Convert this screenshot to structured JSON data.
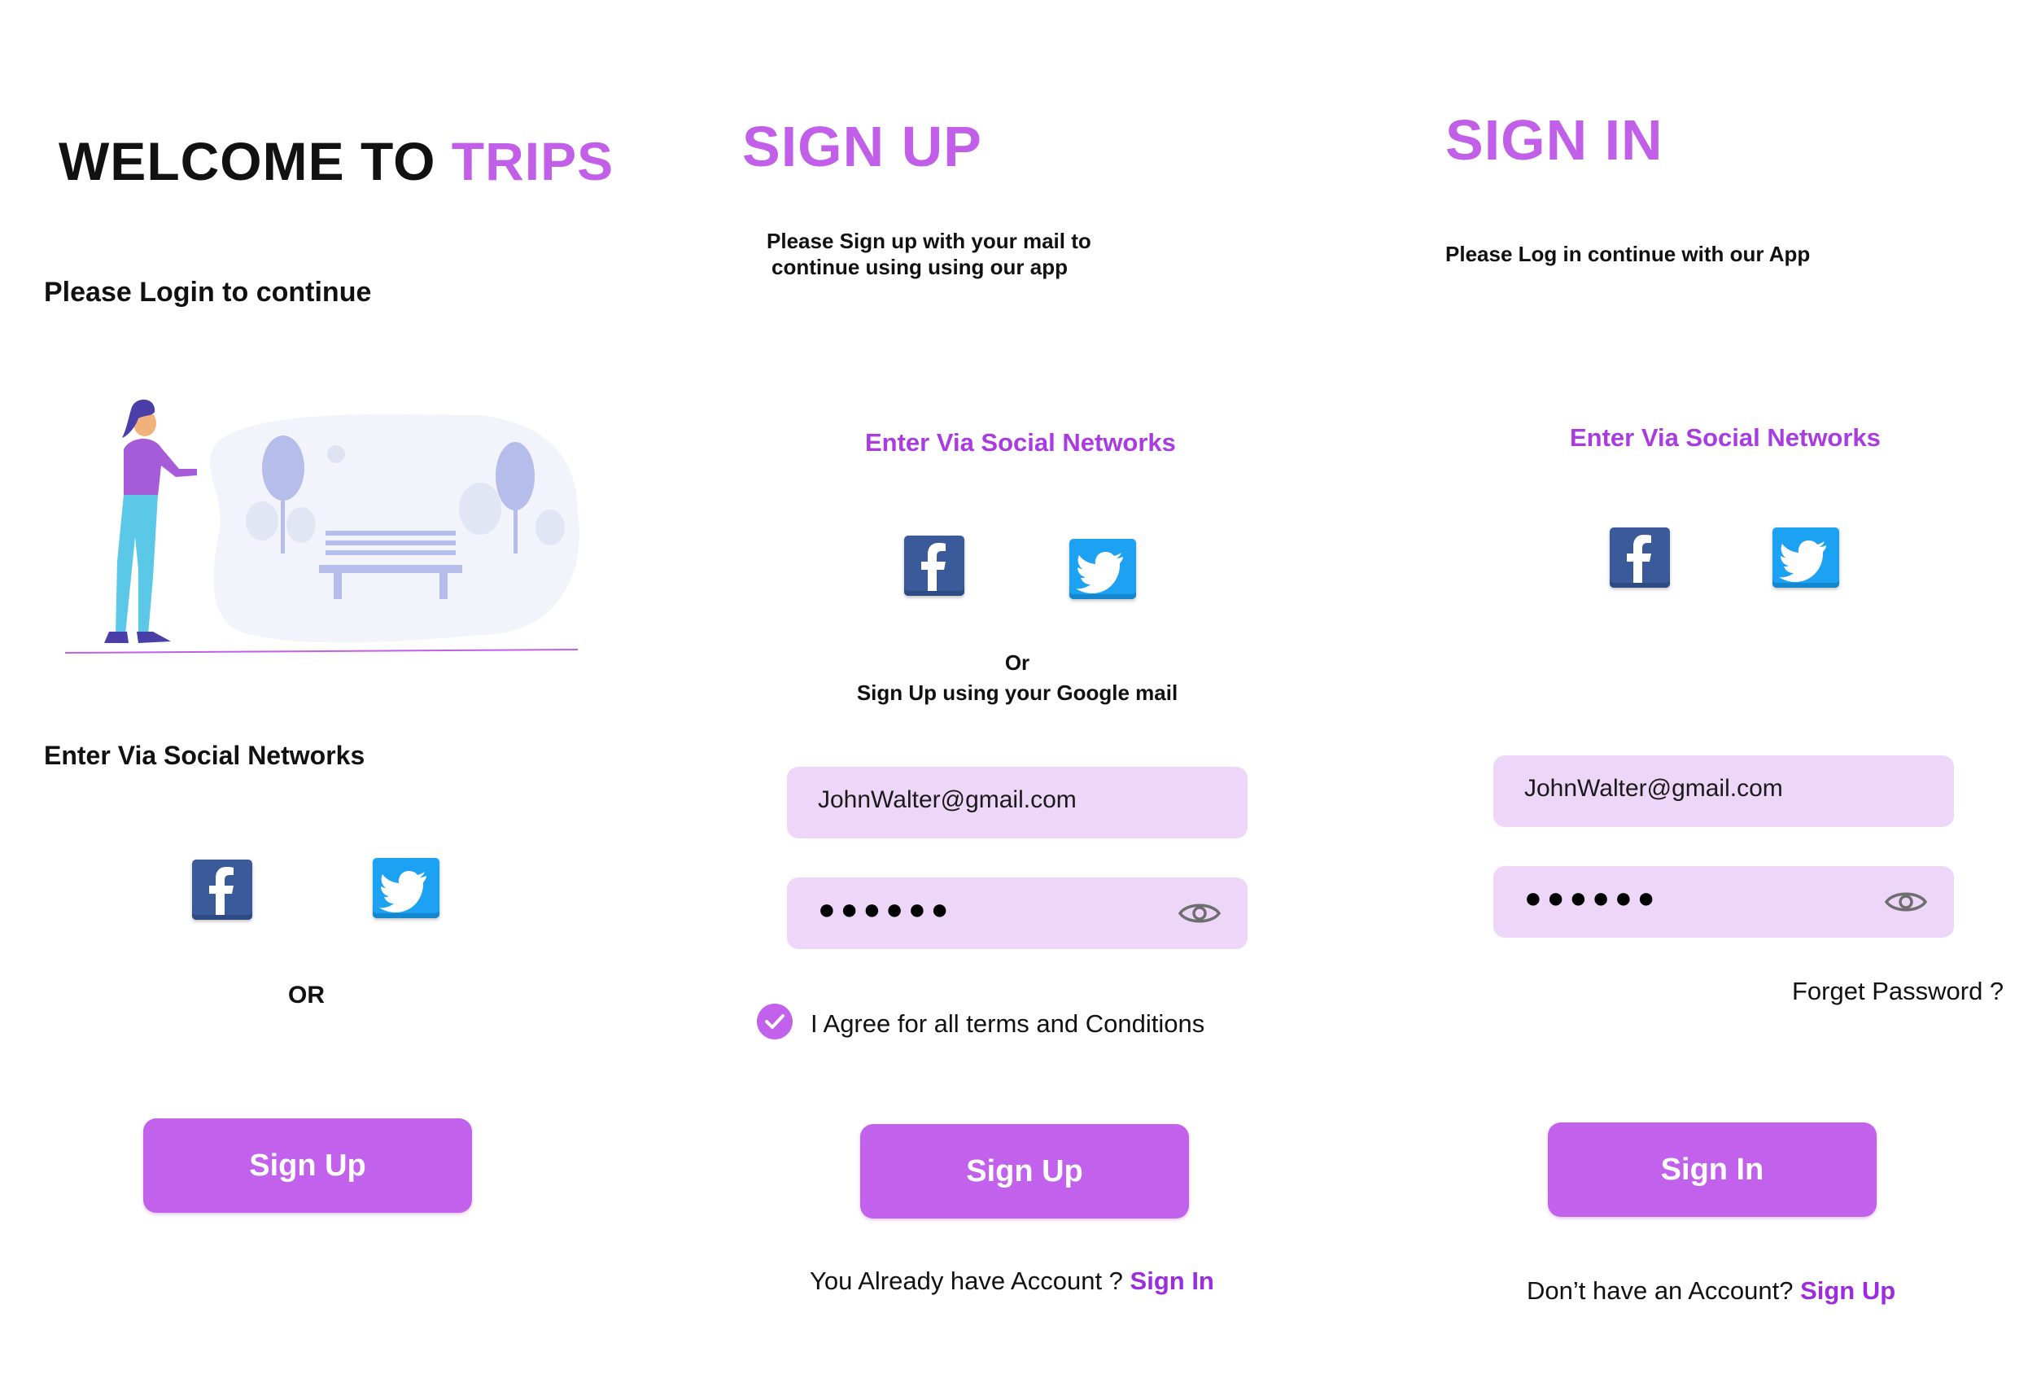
{
  "colors": {
    "accent": "#c15fe8",
    "button": "#c261eb",
    "field": "#eed6f8",
    "link": "#9b2ce0",
    "facebook": "#3b5a9a",
    "twitter": "#1da1f2"
  },
  "welcome": {
    "title_prefix": "WELCOME TO ",
    "title_brand": "TRIPS",
    "subtitle": "Please Login to continue",
    "social_heading": "Enter Via Social Networks",
    "or_text": "OR",
    "signup_button": "Sign Up",
    "icons": [
      "facebook-icon",
      "twitter-icon",
      "park-illustration"
    ]
  },
  "signup": {
    "title": "SIGN UP",
    "description_line1": "Please Sign up with your mail to",
    "description_line2": "continue using using our app",
    "social_heading": "Enter Via Social Networks",
    "or_text": "Or",
    "google_text": "Sign Up using your Google mail",
    "email_value": "JohnWalter@gmail.com",
    "password_mask": "●●●●●●",
    "agree_text": "I Agree for all terms and Conditions",
    "button": "Sign Up",
    "footer_text": "You Already have Account ? ",
    "footer_link": "Sign In"
  },
  "signin": {
    "title": "SIGN IN",
    "description": "Please  Log in continue with our App",
    "social_heading": "Enter Via Social Networks",
    "email_value": "JohnWalter@gmail.com",
    "password_mask": "●●●●●●",
    "forgot": "Forget Password ?",
    "button": "Sign In",
    "footer_text": "Don’t have an Account? ",
    "footer_link": "Sign Up"
  }
}
